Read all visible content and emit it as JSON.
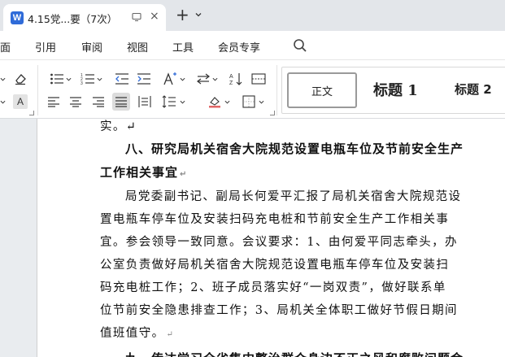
{
  "titlebar": {
    "tab_icon_letter": "W",
    "tab_title": "4.15党...要（7次）",
    "new_tab_symbol": "+"
  },
  "menu": {
    "items": [
      "面",
      "引用",
      "审阅",
      "视图",
      "工具",
      "会员专享"
    ]
  },
  "ribbon": {
    "styles": {
      "normal": "正文",
      "heading1": "标题  1",
      "heading2": "标题  2"
    },
    "font_color_letter": "A"
  },
  "document": {
    "lines": [
      "实。↵",
      "八、研究局机关宿舍大院规范设置电瓶车位及节前安全生产",
      "工作相关事宜",
      "局党委副书记、副局长何爱平汇报了局机关宿舍大院规范设",
      "置电瓶车停车位及安装扫码充电桩和节前安全生产工作相关事",
      "宜。参会领导一致同意。会议要求：1、由何爱平同志牵头，办",
      "公室负责做好局机关宿舍大院规范设置电瓶车停车位及安装扫",
      "码充电桩工作；2、班子成员落实好“一岗双责”，做好联系单",
      "位节前安全隐患排查工作；3、局机关全体职工做好节假日期间",
      "值班值守。",
      "九、传达学习全省集中整治群众身边不正之风和腐败问题会"
    ],
    "paragraph_mark": "↵"
  }
}
